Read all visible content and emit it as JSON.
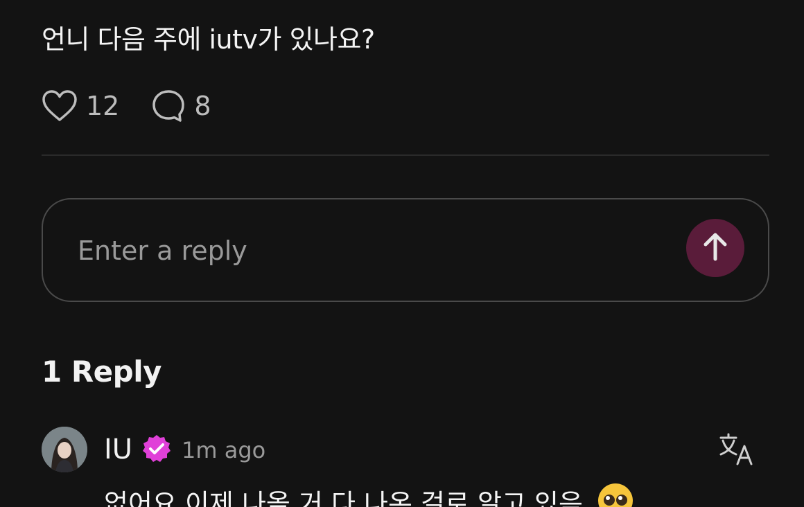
{
  "post": {
    "text": "언니 다음 주에 iutv가 있나요?",
    "likes": "12",
    "comments": "8",
    "like_icon": "heart-outline-icon",
    "comment_icon": "speech-bubble-icon"
  },
  "reply_box": {
    "placeholder": "Enter a reply",
    "send_icon": "arrow-up-icon",
    "send_color": "#5a1c3a"
  },
  "replies_header": "1 Reply",
  "replies": [
    {
      "author": "IU",
      "verified_color": "#e040d8",
      "time": "1m ago",
      "text": "없어요 이제 나올 거 다 나온 걸로 알고 있음",
      "emoji": "pleading-face-emoji",
      "translate_icon": "translate-icon"
    }
  ],
  "colors": {
    "background": "#131313",
    "divider": "#2a2a2a",
    "muted_text": "#9a9a9a"
  }
}
